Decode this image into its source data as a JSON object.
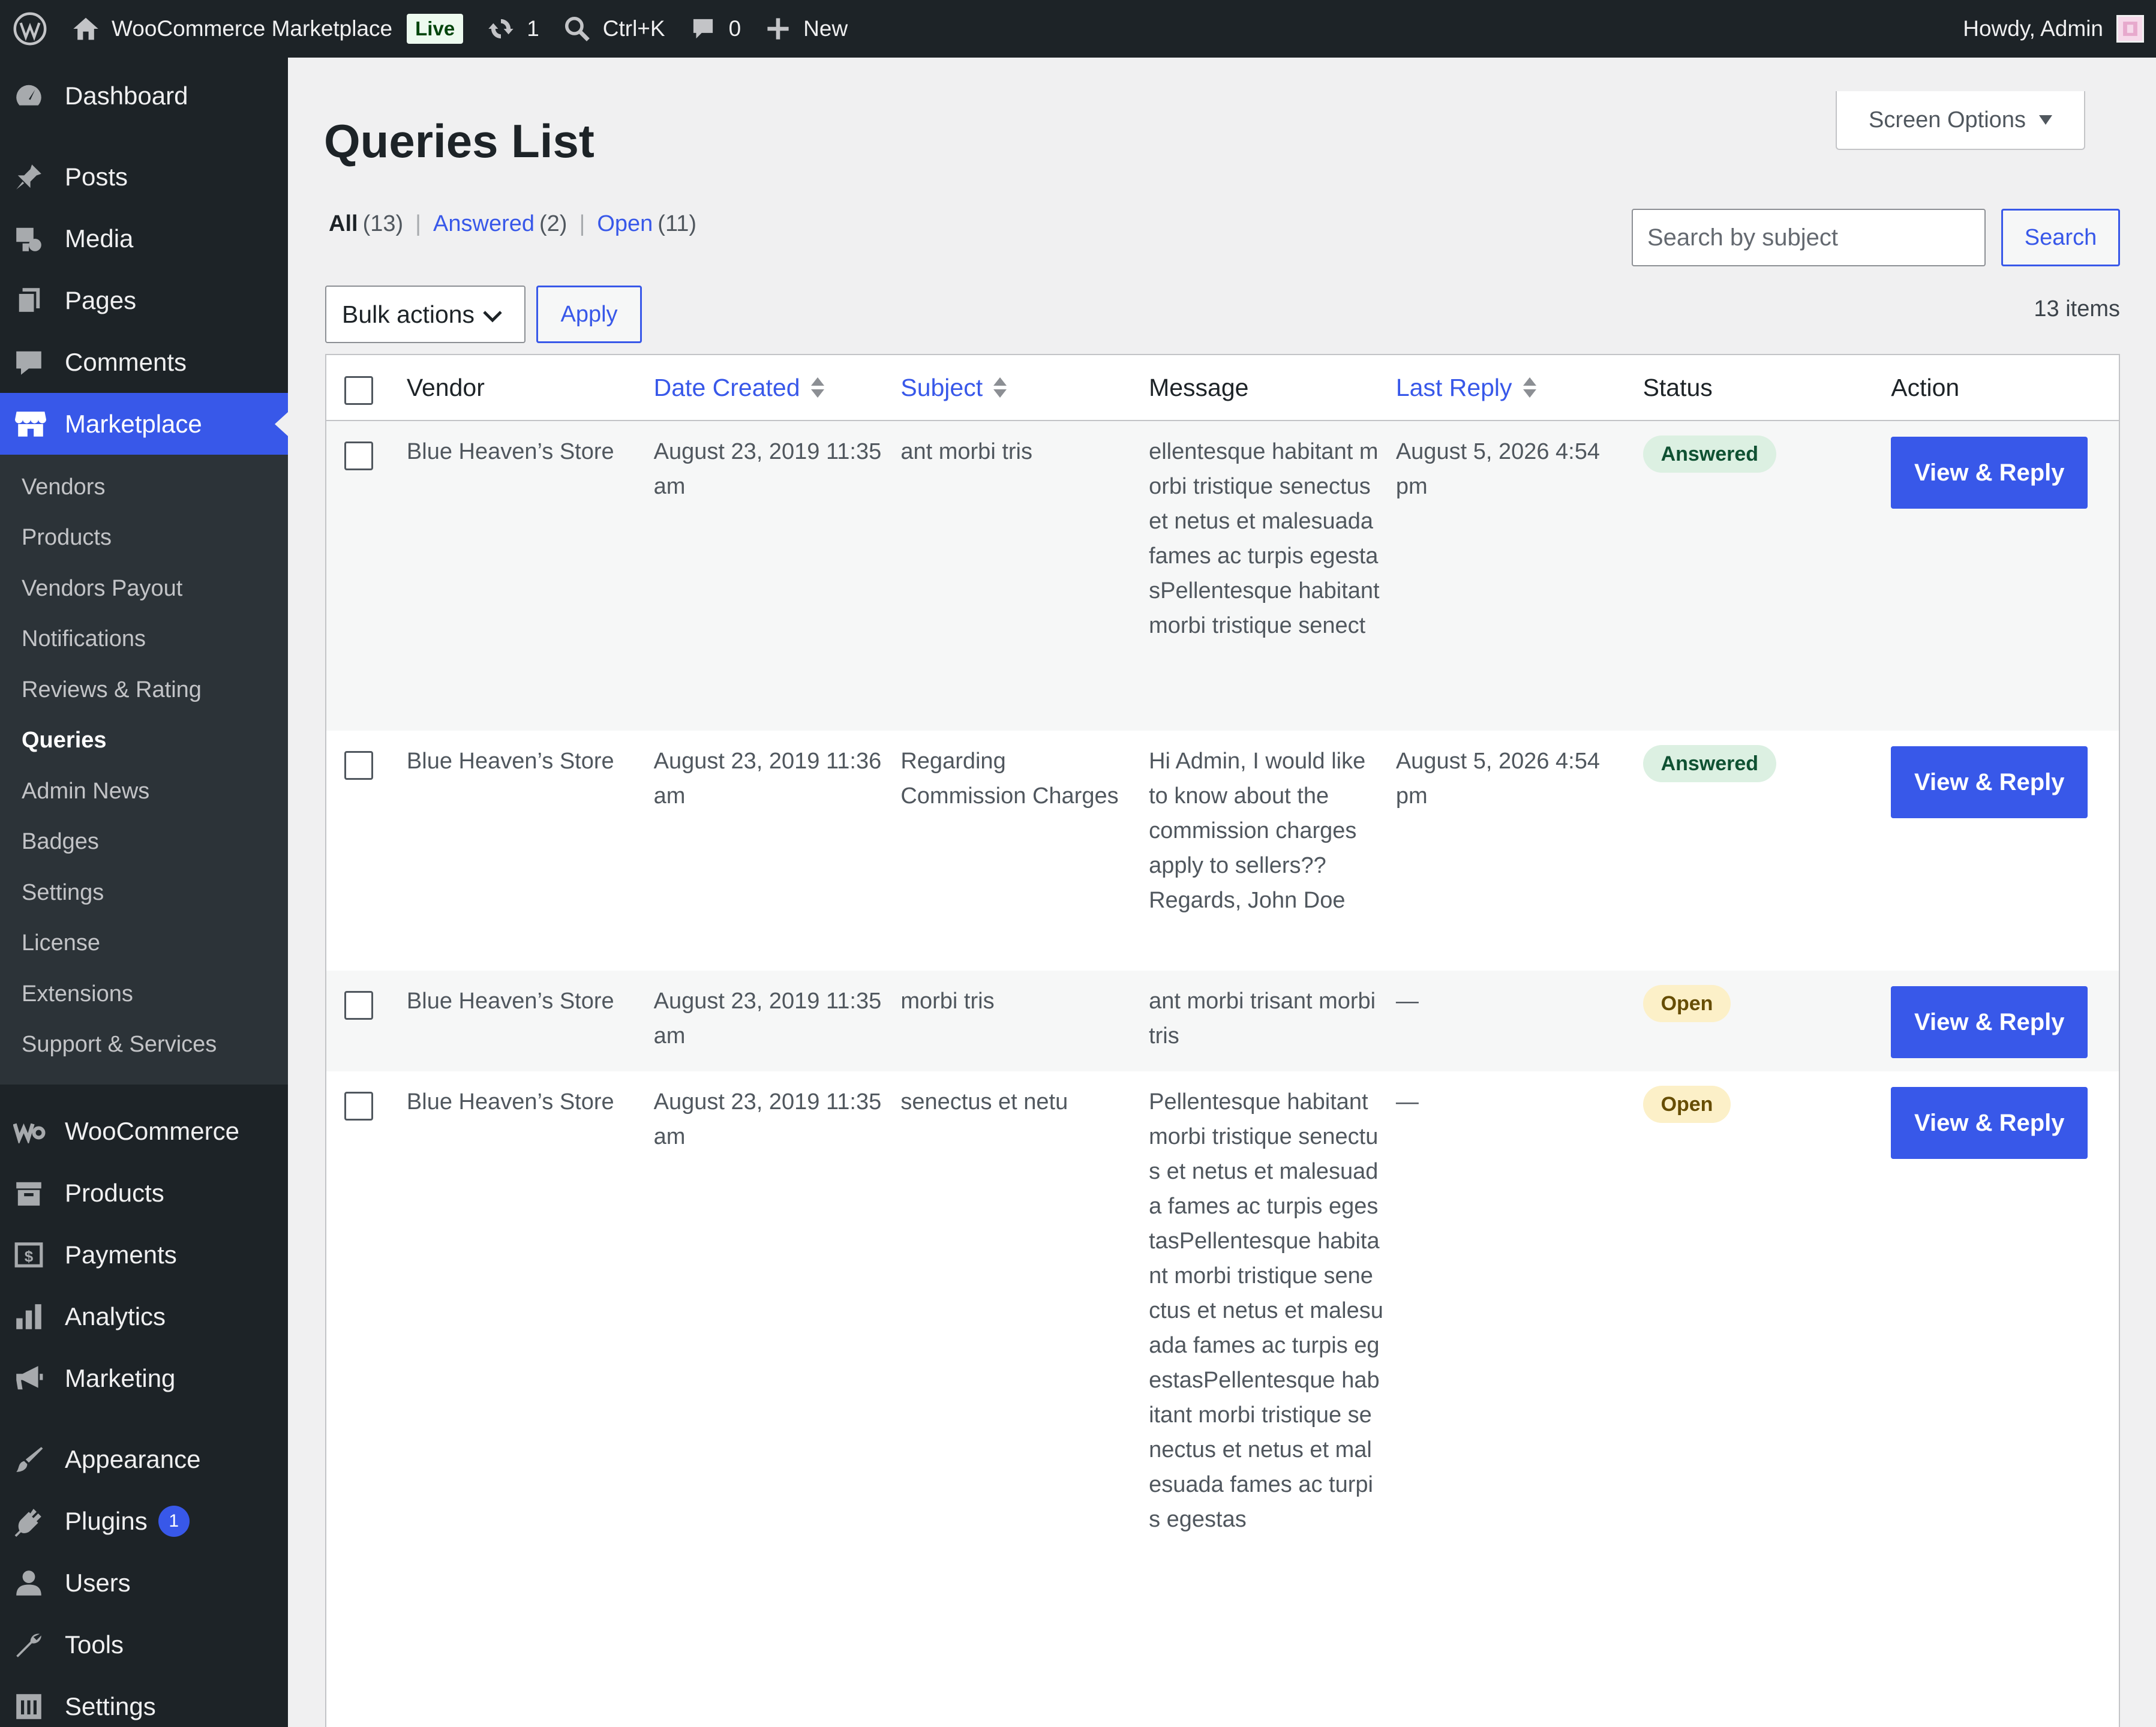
{
  "adminbar": {
    "site_name": "WooCommerce Marketplace",
    "live_label": "Live",
    "updates_count": "1",
    "command_shortcut": "Ctrl+K",
    "comments_count": "0",
    "new_label": "New",
    "greeting": "Howdy, Admin"
  },
  "sidebar": {
    "dashboard": "Dashboard",
    "posts": "Posts",
    "media": "Media",
    "pages": "Pages",
    "comments": "Comments",
    "marketplace": "Marketplace",
    "submenu": [
      "Vendors",
      "Products",
      "Vendors Payout",
      "Notifications",
      "Reviews & Rating",
      "Queries",
      "Admin News",
      "Badges",
      "Settings",
      "License",
      "Extensions",
      "Support & Services"
    ],
    "woocommerce": "WooCommerce",
    "products": "Products",
    "payments": "Payments",
    "analytics": "Analytics",
    "marketing": "Marketing",
    "appearance": "Appearance",
    "plugins": "Plugins",
    "plugins_count": "1",
    "users": "Users",
    "tools": "Tools",
    "settings": "Settings"
  },
  "page": {
    "title": "Queries List",
    "screen_options": "Screen Options",
    "filters": {
      "all_label": "All",
      "all_count": "(13)",
      "answered_label": "Answered",
      "answered_count": "(2)",
      "open_label": "Open",
      "open_count": "(11)"
    },
    "search_placeholder": "Search by subject",
    "search_button": "Search",
    "bulk_actions": "Bulk actions",
    "apply_button": "Apply",
    "items_count": "13 items"
  },
  "table": {
    "headers": {
      "vendor": "Vendor",
      "date_created": "Date Created",
      "subject": "Subject",
      "message": "Message",
      "last_reply": "Last Reply",
      "status": "Status",
      "action": "Action"
    },
    "rows": [
      {
        "vendor": "Blue Heaven’s Store",
        "date": "August 23, 2019 11:35 am",
        "subject": "ant morbi tris",
        "message": "ellentesque habitant morbi tristique senectus et netus et malesuada fames ac turpis egestasPellentesque habitant morbi tristique senect",
        "last_reply": "August 5, 2026 4:54 pm",
        "status": "Answered",
        "action": "View & Reply"
      },
      {
        "vendor": "Blue Heaven’s Store",
        "date": "August 23, 2019 11:36 am",
        "subject": "Regarding Commission Charges",
        "message": "Hi Admin, I would like to know about the commission charges apply to sellers?? Regards, John Doe",
        "last_reply": "August 5, 2026 4:54 pm",
        "status": "Answered",
        "action": "View & Reply"
      },
      {
        "vendor": "Blue Heaven’s Store",
        "date": "August 23, 2019 11:35 am",
        "subject": "morbi tris",
        "message": "ant morbi trisant morbi tris",
        "last_reply": "—",
        "status": "Open",
        "action": "View & Reply"
      },
      {
        "vendor": "Blue Heaven’s Store",
        "date": "August 23, 2019 11:35 am",
        "subject": "senectus et netu",
        "message": "Pellentesque habitant morbi tristique senectus et netus et malesuada fames ac turpis egestasPellentesque habitant morbi tristique senectus et netus et malesuada fames ac turpis egestasPellentesque habitant morbi tristique senectus et netus et malesuada fames ac turpis egestas",
        "last_reply": "—",
        "status": "Open",
        "action": "View & Reply"
      }
    ]
  },
  "colors": {
    "accent": "#3858e9",
    "sidebar_bg": "#1d2327",
    "answered_badge": "#dcf0e2",
    "open_badge": "#fcf0c8"
  }
}
